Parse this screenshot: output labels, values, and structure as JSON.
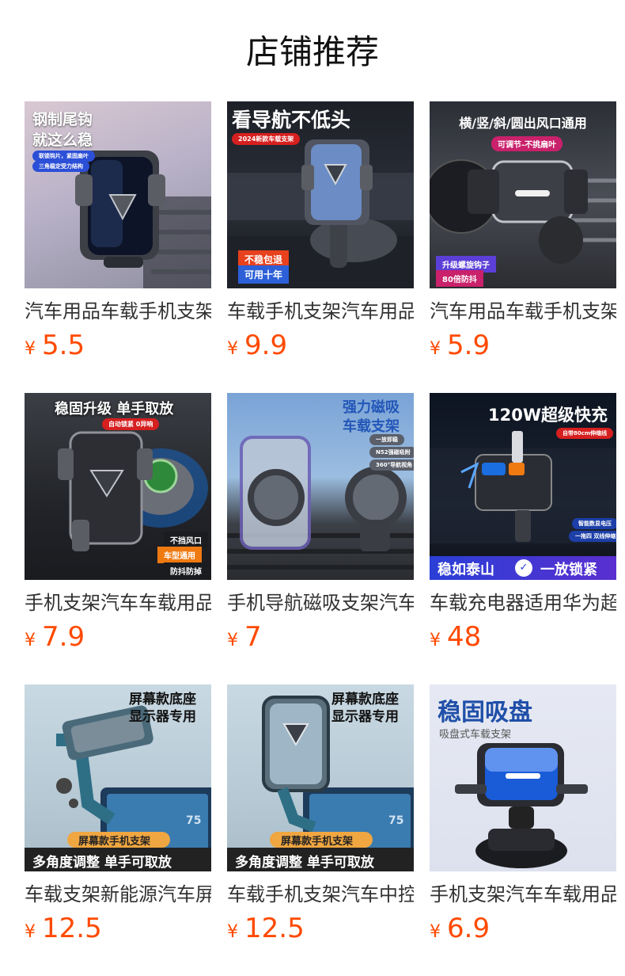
{
  "page": {
    "title": "店铺推荐"
  },
  "currency": "¥",
  "products": [
    {
      "name": "汽车用品车载手机支架",
      "price": "5.5",
      "overlay": {
        "headline_1": "钢制尾钩",
        "headline_2": "就这么稳",
        "badge_1": "联锁钩片，紧固扇叶",
        "badge_2": "三角稳定受力结构"
      }
    },
    {
      "name": "车载手机支架汽车用品",
      "price": "9.9",
      "overlay": {
        "headline": "看导航不低头",
        "badge": "2024新款车载支架",
        "tag_1": "不稳包退",
        "tag_2": "可用十年"
      }
    },
    {
      "name": "汽车用品车载手机支架",
      "price": "5.9",
      "overlay": {
        "headline": "横/竖/斜/圆出风口通用",
        "badge": "可调节-不挑扇叶",
        "tag_1": "升级螺旋钩子",
        "tag_2": "80倍防抖"
      }
    },
    {
      "name": "手机支架汽车车载用品",
      "price": "7.9",
      "overlay": {
        "headline": "稳固升级  单手取放",
        "badge": "自动锁紧 0异响",
        "tag_1": "不挡风口",
        "tag_2": "车型通用",
        "tag_3": "防抖防掉"
      }
    },
    {
      "name": "手机导航磁吸支架汽车",
      "price": "7",
      "overlay": {
        "headline_1": "强力磁吸",
        "headline_2": "车载支架",
        "badge_1": "一放即稳",
        "badge_2": "N52强磁吸附",
        "badge_3": "360°导航视角"
      }
    },
    {
      "name": "车载充电器适用华为超级快充",
      "price": "48",
      "overlay": {
        "headline": "120W超级快充",
        "badge": "自带80cm伸缩线",
        "tag_1": "智能数显电压",
        "tag_2": "一拖四 双线伸缩",
        "bottom_left": "稳如泰山",
        "bottom_right": "一放锁紧"
      }
    },
    {
      "name": "车载支架新能源汽车屏幕",
      "price": "12.5",
      "overlay": {
        "headline_1": "屏幕款底座",
        "headline_2": "显示器专用",
        "ribbon": "屏幕款手机支架",
        "bottom": "多角度调整    单手可取放",
        "screen_num": "75"
      }
    },
    {
      "name": "车载手机支架汽车中控",
      "price": "12.5",
      "overlay": {
        "headline_1": "屏幕款底座",
        "headline_2": "显示器专用",
        "ribbon": "屏幕款手机支架",
        "bottom": "多角度调整    单手可取放",
        "screen_num": "75"
      }
    },
    {
      "name": "手机支架汽车车载用品",
      "price": "6.9",
      "overlay": {
        "headline": "稳固吸盘",
        "sub": "吸盘式车载支架"
      }
    }
  ]
}
